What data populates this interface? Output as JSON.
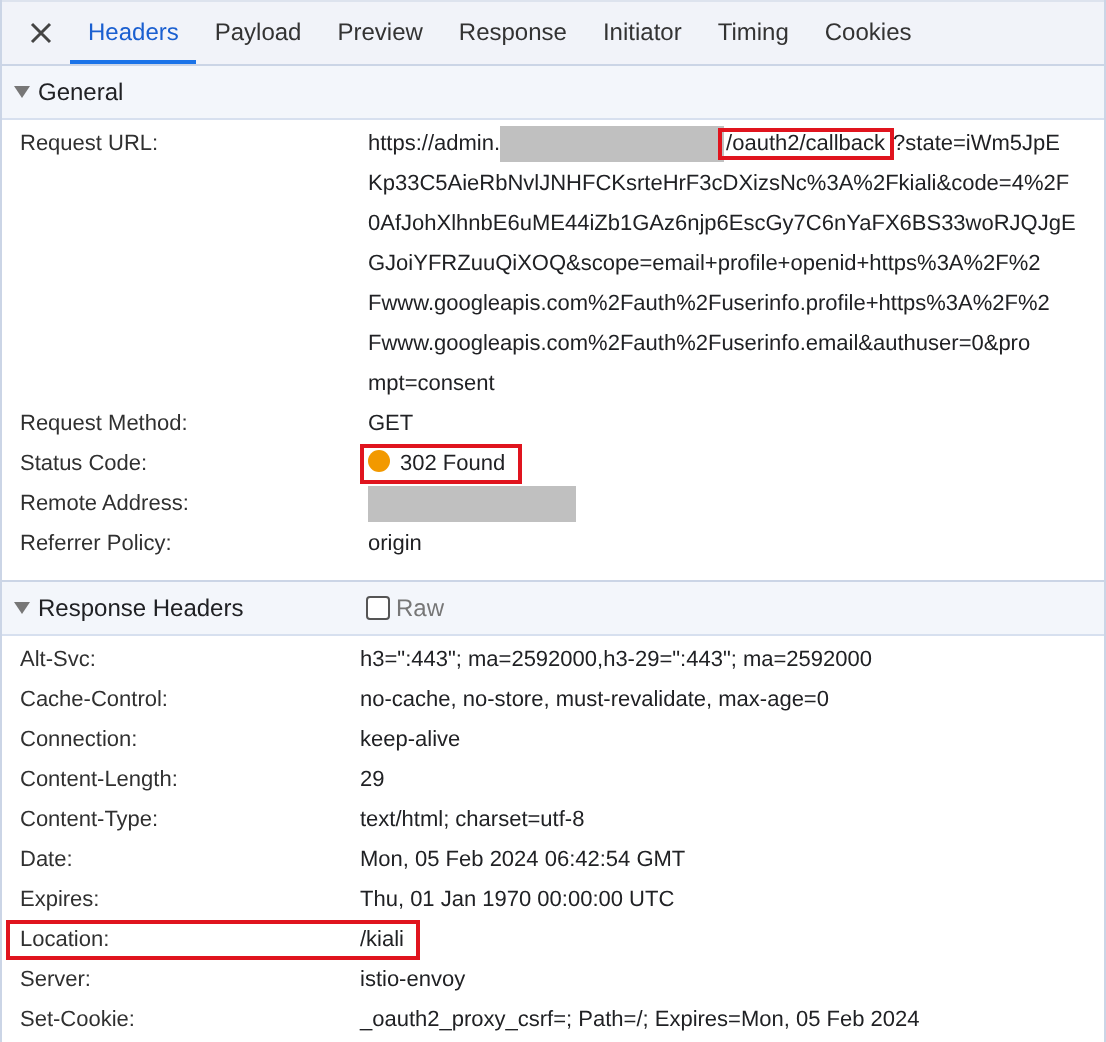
{
  "tabs": [
    {
      "label": "Headers",
      "selected": true
    },
    {
      "label": "Payload",
      "selected": false
    },
    {
      "label": "Preview",
      "selected": false
    },
    {
      "label": "Response",
      "selected": false
    },
    {
      "label": "Initiator",
      "selected": false
    },
    {
      "label": "Timing",
      "selected": false
    },
    {
      "label": "Cookies",
      "selected": false
    }
  ],
  "general": {
    "title": "General",
    "expanded": true,
    "request_url": {
      "label": "Request URL:",
      "prefix": "https://admin.",
      "highlighted_part": "/oauth2/callback",
      "first_line_rest": "?state=iWm5JpE",
      "lines": [
        "Kp33C5AieRbNvlJNHFCKsrteHrF3cDXizsNc%3A%2Fkiali&code=4%2F",
        "0AfJohXlhnbE6uME44iZb1GAz6njp6EscGy7C6nYaFX6BS33woRJQJgE",
        "GJoiYFRZuuQiXOQ&scope=email+profile+openid+https%3A%2F%2",
        "Fwww.googleapis.com%2Fauth%2Fuserinfo.profile+https%3A%2F%2",
        "Fwww.googleapis.com%2Fauth%2Fuserinfo.email&authuser=0&pro",
        "mpt=consent"
      ]
    },
    "rows": [
      {
        "label": "Request Method:",
        "value": "GET",
        "kind": "text",
        "highlighted": false
      },
      {
        "label": "Status Code:",
        "value": "302 Found",
        "kind": "status",
        "color": "#f29900",
        "highlighted": true
      },
      {
        "label": "Remote Address:",
        "kind": "redacted"
      },
      {
        "label": "Referrer Policy:",
        "value": "origin",
        "kind": "text",
        "highlighted": false
      }
    ]
  },
  "response_headers": {
    "title": "Response Headers",
    "expanded": true,
    "raw": {
      "label": "Raw",
      "checked": false
    },
    "rows": [
      {
        "label": "Alt-Svc:",
        "value": "h3=\":443\"; ma=2592000,h3-29=\":443\"; ma=2592000",
        "highlighted": false
      },
      {
        "label": "Cache-Control:",
        "value": "no-cache, no-store, must-revalidate, max-age=0",
        "highlighted": false
      },
      {
        "label": "Connection:",
        "value": "keep-alive",
        "highlighted": false
      },
      {
        "label": "Content-Length:",
        "value": "29",
        "highlighted": false
      },
      {
        "label": "Content-Type:",
        "value": "text/html; charset=utf-8",
        "highlighted": false
      },
      {
        "label": "Date:",
        "value": "Mon, 05 Feb 2024 06:42:54 GMT",
        "highlighted": false
      },
      {
        "label": "Expires:",
        "value": "Thu, 01 Jan 1970 00:00:00 UTC",
        "highlighted": false
      },
      {
        "label": "Location:",
        "value": "/kiali",
        "highlighted": true
      },
      {
        "label": "Server:",
        "value": "istio-envoy",
        "highlighted": false
      },
      {
        "label": "Set-Cookie:",
        "value": "_oauth2_proxy_csrf=; Path=/; Expires=Mon, 05 Feb 2024",
        "highlighted": false
      }
    ]
  }
}
